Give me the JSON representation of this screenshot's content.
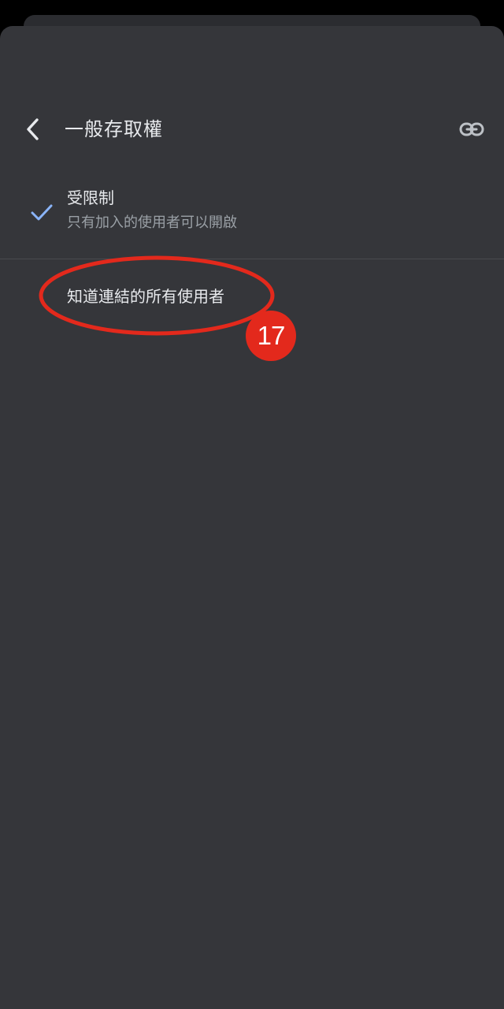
{
  "header": {
    "title": "一般存取權",
    "back_icon": "chevron-left-icon",
    "link_icon": "link-icon"
  },
  "options": [
    {
      "title": "受限制",
      "subtitle": "只有加入的使用者可以開啟",
      "selected": true,
      "icon": "check-icon"
    },
    {
      "title": "知道連結的所有使用者",
      "selected": false
    }
  ],
  "annotation": {
    "step_number": "17",
    "color": "#e3291c"
  },
  "colors": {
    "sheet_background": "#35363a",
    "text_primary": "#e8eaed",
    "text_secondary": "#9aa0a6",
    "check_accent": "#8ab4f8"
  }
}
